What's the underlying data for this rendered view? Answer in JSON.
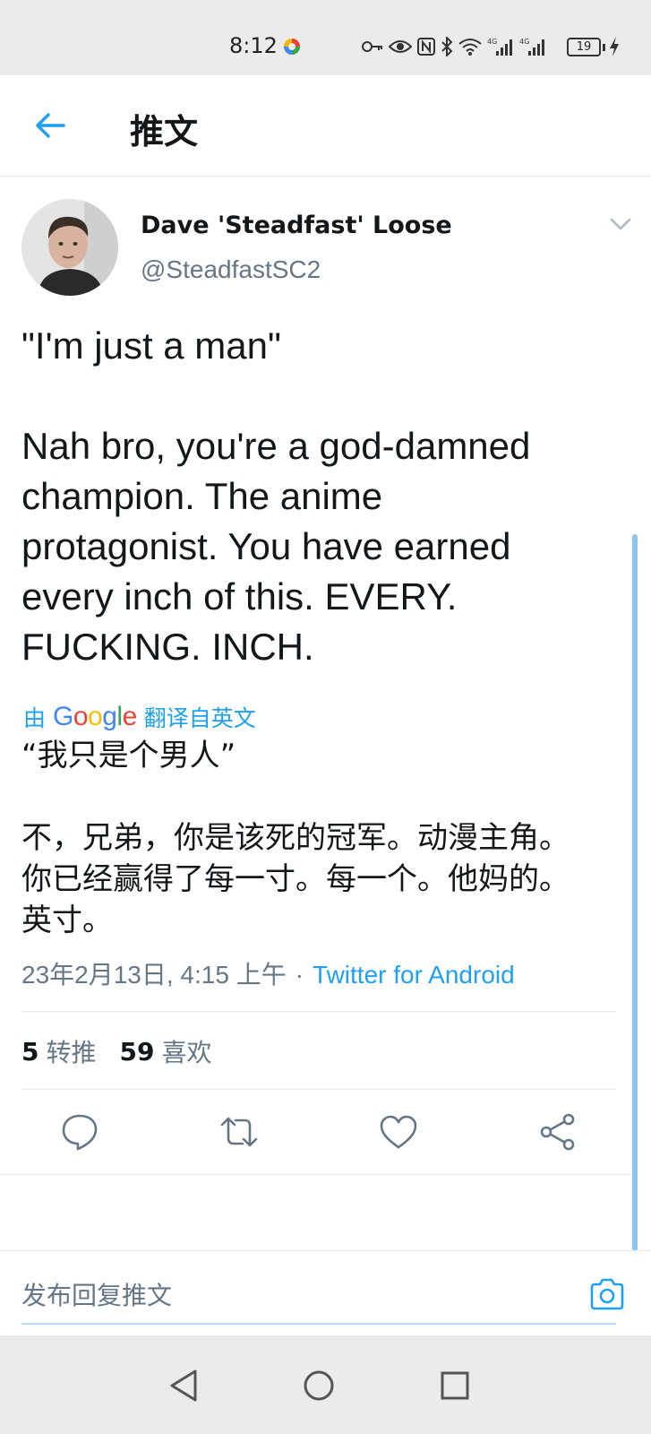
{
  "status_bar": {
    "time": "8:12",
    "battery": "19",
    "icons": [
      "key-icon",
      "eye-icon",
      "nfc-icon",
      "bluetooth-icon",
      "wifi-icon",
      "signal-4g-icon",
      "signal-4g-icon",
      "battery-icon",
      "charging-icon"
    ]
  },
  "header": {
    "title": "推文"
  },
  "tweet": {
    "author_name": "Dave 'Steadfast' Loose",
    "author_handle": "@SteadfastSC2",
    "text": "\"I'm just a man\"\n\nNah bro, you're a god-damned\nchampion. The anime\nprotagonist. You have earned\nevery inch of this. EVERY.\nFUCKING. INCH.",
    "translate_prefix": "由",
    "translate_suffix": "翻译自英文",
    "translated_text": "“我只是个男人”\n\n不，兄弟，你是该死的冠军。动漫主角。\n你已经赢得了每一寸。每一个。他妈的。\n英寸。",
    "timestamp": "23年2月13日, 4:15 上午",
    "separator": "·",
    "source": "Twitter for Android",
    "retweets_count": "5",
    "retweets_label": "转推",
    "likes_count": "59",
    "likes_label": "喜欢"
  },
  "reply": {
    "placeholder": "发布回复推文"
  },
  "colors": {
    "accent": "#1da1f2",
    "secondary_text": "#657786",
    "divider": "#e6ecf0"
  }
}
